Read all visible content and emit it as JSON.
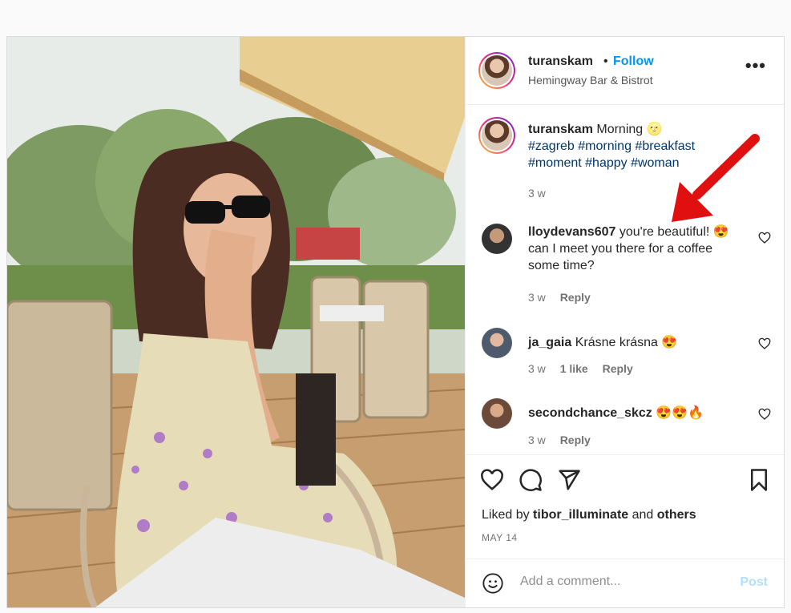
{
  "header": {
    "username": "turanskam",
    "separator": "•",
    "follow_label": "Follow",
    "location": "Hemingway Bar & Bistrot",
    "more_label": "•••"
  },
  "caption": {
    "username": "turanskam",
    "text": "Morning 🌝",
    "hashtags_line1": "#zagreb #morning #breakfast",
    "hashtags_line2": "#moment #happy #woman",
    "time": "3 w"
  },
  "comments": [
    {
      "username": "lloydevans607",
      "text": "you're beautiful! 😍 can I meet you there for a coffee some time?",
      "time": "3 w",
      "likes": "",
      "reply": "Reply"
    },
    {
      "username": "ja_gaia",
      "text": "Krásne krásna 😍",
      "time": "3 w",
      "likes": "1 like",
      "reply": "Reply"
    },
    {
      "username": "secondchance_skcz",
      "text": "😍😍🔥",
      "time": "3 w",
      "likes": "",
      "reply": "Reply"
    }
  ],
  "likes": {
    "prefix": "Liked by",
    "user": "tibor_illuminate",
    "joiner": "and",
    "others": "others"
  },
  "date": "MAY 14",
  "composer": {
    "placeholder": "Add a comment...",
    "post_label": "Post"
  },
  "icons": [
    "heart-icon",
    "comment-icon",
    "share-icon",
    "bookmark-icon",
    "emoji-icon",
    "more-icon",
    "red-arrow"
  ],
  "colors": {
    "follow": "#0095f6",
    "hashtag": "#00376b",
    "post_disabled": "#b2dffc",
    "arrow": "#e01010"
  }
}
